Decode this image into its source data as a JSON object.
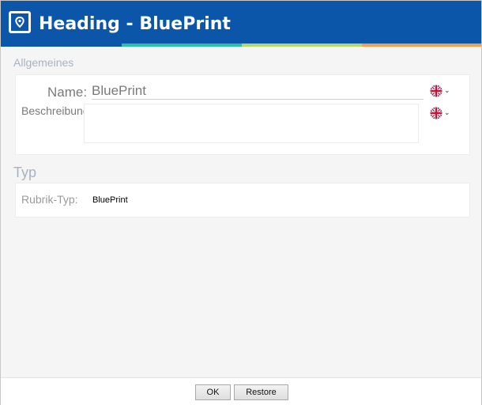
{
  "window": {
    "title": "Heading - BluePrint",
    "icon": "map-pin-window-icon",
    "accent_color": "#0b56a8",
    "stripe_colors": [
      "#2cc1a0",
      "#b6d86a",
      "#f0a050"
    ]
  },
  "general": {
    "section_label": "Allgemeines",
    "name_label": "Name:",
    "name_value": "BluePrint",
    "description_label": "Beschreibung:",
    "description_value": "",
    "language_icon": "uk-flag-icon"
  },
  "type": {
    "section_label": "Typ",
    "rubric_label": "Rubrik-Typ:",
    "rubric_value": "BluePrint"
  },
  "footer": {
    "ok_label": "OK",
    "restore_label": "Restore"
  }
}
